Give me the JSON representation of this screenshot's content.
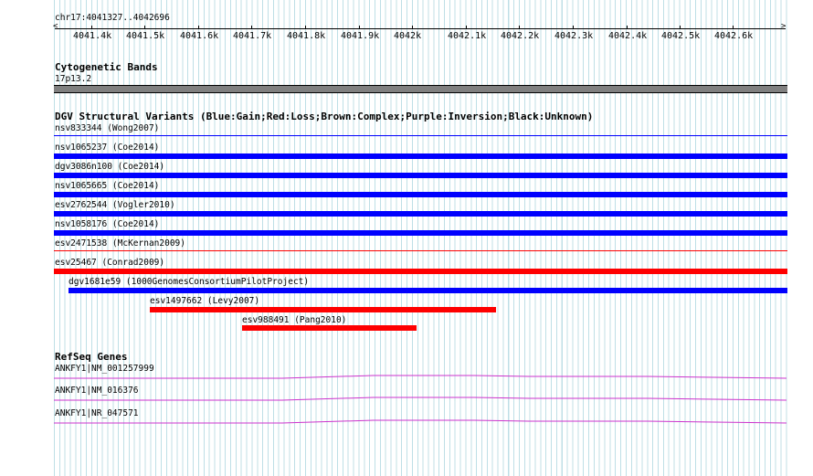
{
  "ruler": {
    "position": "chr17:4041327..4042696",
    "ticks": [
      "4041.4k",
      "4041.5k",
      "4041.6k",
      "4041.7k",
      "4041.8k",
      "4041.9k",
      "4042k",
      "4042.1k",
      "4042.2k",
      "4042.3k",
      "4042.4k",
      "4042.5k",
      "4042.6k"
    ]
  },
  "cytoband": {
    "title": "Cytogenetic Bands",
    "band_label": "17p13.2",
    "band_color": "#808080"
  },
  "dgv": {
    "title": "DGV Structural Variants (Blue:Gain;Red:Loss;Brown:Complex;Purple:Inversion;Black:Unknown)",
    "colors": {
      "gain": "#0000ff",
      "loss": "#ff0000",
      "grid": "#bfdfe6"
    },
    "variants": [
      {
        "label": "nsv833344 (Wong2007)",
        "type": "gain",
        "style": "thin"
      },
      {
        "label": "nsv1065237 (Coe2014)",
        "type": "gain",
        "style": "thick"
      },
      {
        "label": "dgv3086n100 (Coe2014)",
        "type": "gain",
        "style": "thick"
      },
      {
        "label": "nsv1065665 (Coe2014)",
        "type": "gain",
        "style": "thick"
      },
      {
        "label": "esv2762544 (Vogler2010)",
        "type": "gain",
        "style": "thick"
      },
      {
        "label": "nsv1058176 (Coe2014)",
        "type": "gain",
        "style": "thick"
      },
      {
        "label": "esv2471538 (McKernan2009)",
        "type": "loss",
        "style": "thin"
      },
      {
        "label": "esv25467 (Conrad2009)",
        "type": "loss",
        "style": "thick"
      },
      {
        "label": "dgv1681e59 (1000GenomesConsortiumPilotProject)",
        "type": "gain",
        "style": "thick"
      },
      {
        "label": "esv1497662 (Levy2007)",
        "type": "loss",
        "style": "thick"
      },
      {
        "label": "esv988491 (Pang2010)",
        "type": "loss",
        "style": "thick"
      }
    ]
  },
  "refseq": {
    "title": "RefSeq Genes",
    "color": "#cc33cc",
    "genes": [
      {
        "label": "ANKFY1|NM_001257999"
      },
      {
        "label": "ANKFY1|NM_016376"
      },
      {
        "label": "ANKFY1|NR_047571"
      }
    ]
  }
}
